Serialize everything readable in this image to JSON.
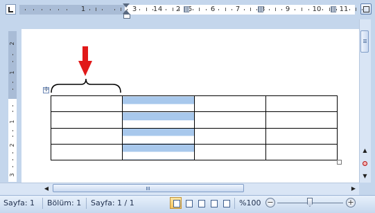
{
  "ruler": {
    "labels": [
      "1",
      "1",
      "2",
      "3",
      "4",
      "5",
      "6",
      "7",
      "8",
      "9",
      "10",
      "11"
    ],
    "vertical_labels": [
      "2",
      "1",
      "1",
      "2",
      "3"
    ]
  },
  "table": {
    "rows": 4,
    "cols": 4,
    "selected_column": 2
  },
  "status": {
    "page": "Sayfa: 1",
    "section": "Bölüm: 1",
    "page_of": "Sayfa: 1 / 1",
    "zoom": "%100"
  },
  "icons": {
    "tab_selector": "left-tab-icon",
    "ruler_toggle": "view-ruler-icon",
    "table_move": "table-move-handle-icon",
    "annotation": "red-down-arrow-icon",
    "views": [
      "print-layout-icon",
      "full-screen-reading-icon",
      "web-layout-icon",
      "outline-icon",
      "draft-icon"
    ]
  },
  "colors": {
    "selection": "#a8c8ec",
    "annotation_arrow": "#e11919",
    "chrome": "#c4d6ec"
  }
}
